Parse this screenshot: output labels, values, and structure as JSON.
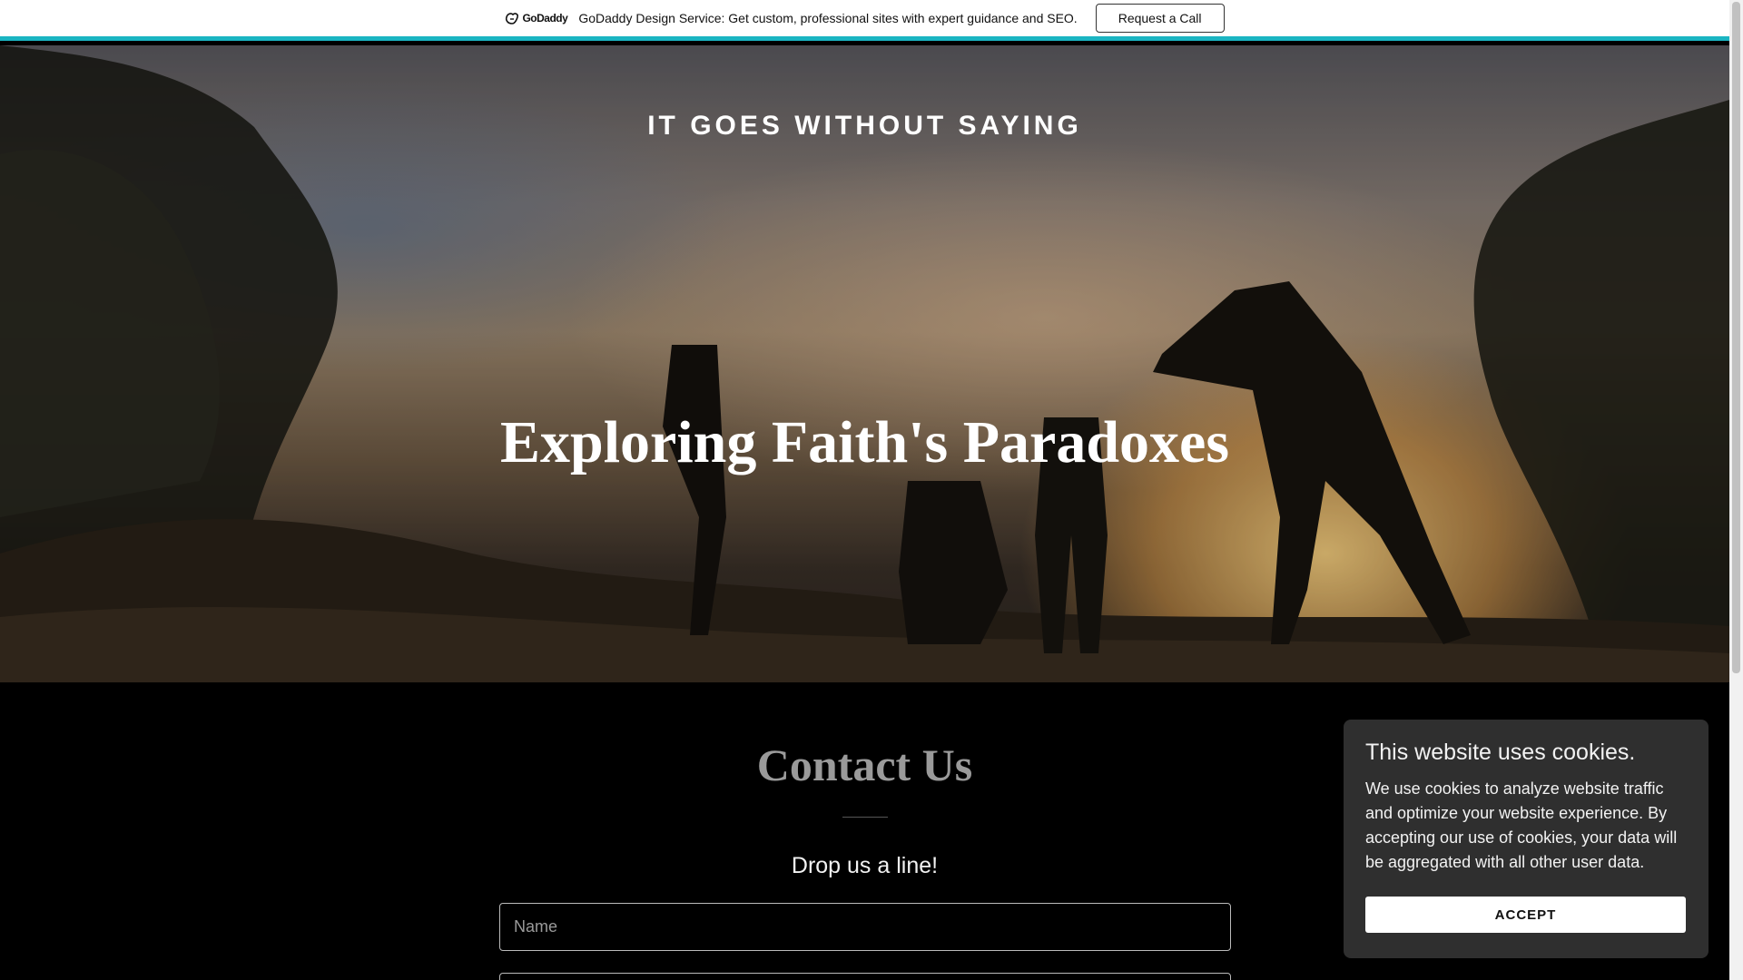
{
  "promo": {
    "logo_text": "GoDaddy",
    "message": "GoDaddy Design Service: Get custom, professional sites with expert guidance and SEO.",
    "button_label": "Request a Call"
  },
  "hero": {
    "site_title": "IT GOES WITHOUT SAYING",
    "heading": "Exploring Faith's Paradoxes"
  },
  "contact": {
    "title": "Contact Us",
    "subtitle": "Drop us a line!",
    "name_placeholder": "Name",
    "email_placeholder": ""
  },
  "cookie_banner": {
    "title": "This website uses cookies.",
    "text": "We use cookies to analyze website traffic and optimize your website experience. By accepting our use of cookies, your data will be aggregated with all other user data.",
    "accept_label": "ACCEPT"
  },
  "colors": {
    "accent_line": "#1bb5c2",
    "background": "#000000",
    "cookie_bg": "#2f2f2f"
  }
}
